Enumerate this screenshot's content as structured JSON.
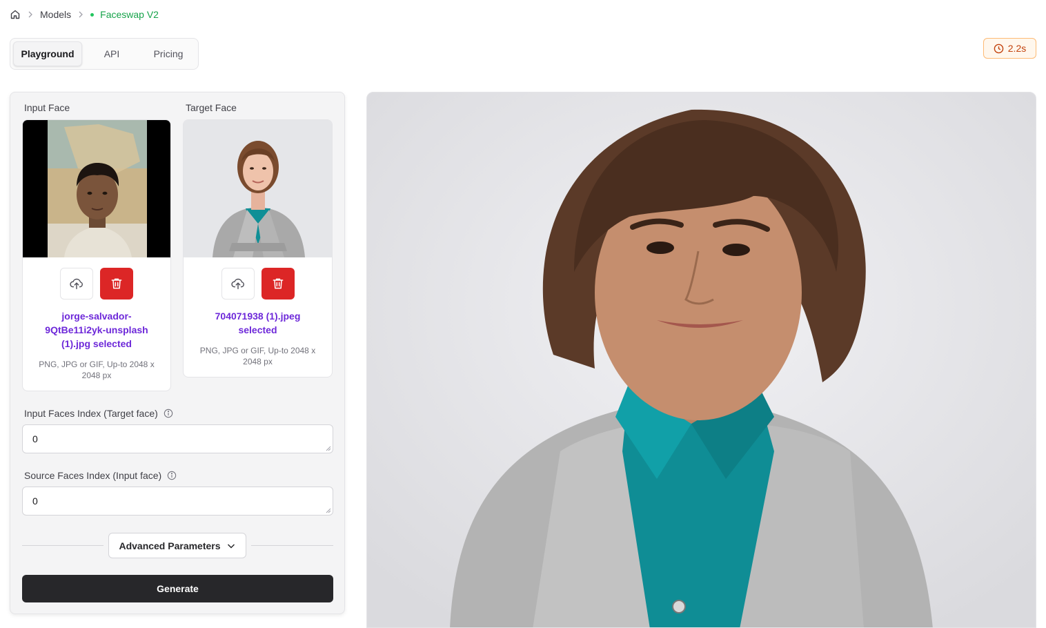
{
  "breadcrumb": {
    "home_icon": "home-icon",
    "items": [
      "Models"
    ],
    "current": "Faceswap V2",
    "current_color": "#16a34a"
  },
  "tabs": [
    {
      "label": "Playground",
      "active": true
    },
    {
      "label": "API",
      "active": false
    },
    {
      "label": "Pricing",
      "active": false
    }
  ],
  "timer": {
    "icon": "clock-icon",
    "value": "2.2s"
  },
  "input_face": {
    "label": "Input Face",
    "file_name": "jorge-salvador-9QtBe11i2yk-unsplash (1).jpg selected",
    "hint": "PNG, JPG or GIF, Up-to 2048 x 2048 px"
  },
  "target_face": {
    "label": "Target Face",
    "file_name": "704071938 (1).jpeg selected",
    "hint": "PNG, JPG or GIF, Up-to 2048 x 2048 px"
  },
  "input_faces_index": {
    "label": "Input Faces Index (Target face)",
    "value": "0"
  },
  "source_faces_index": {
    "label": "Source Faces Index (Input face)",
    "value": "0"
  },
  "advanced": {
    "label": "Advanced Parameters"
  },
  "generate": {
    "label": "Generate"
  },
  "colors": {
    "accent": "#6d28d9",
    "danger": "#dc2626",
    "primary_button": "#27272a",
    "timer": "#c2410c"
  }
}
